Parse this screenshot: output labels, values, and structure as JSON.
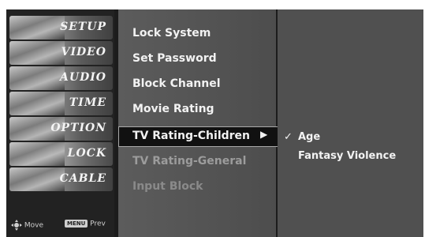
{
  "left_menu": {
    "items": [
      {
        "label": "SETUP"
      },
      {
        "label": "VIDEO"
      },
      {
        "label": "AUDIO"
      },
      {
        "label": "TIME"
      },
      {
        "label": "OPTION"
      },
      {
        "label": "LOCK"
      },
      {
        "label": "CABLE"
      }
    ],
    "footer": {
      "move_label": "Move",
      "prev_badge": "MENU",
      "prev_label": "Prev"
    }
  },
  "lock_menu": {
    "items": [
      {
        "label": "Lock System"
      },
      {
        "label": "Set Password"
      },
      {
        "label": "Block Channel"
      },
      {
        "label": "Movie Rating"
      },
      {
        "label": "TV Rating-Children",
        "arrow": "▶"
      },
      {
        "label": "TV Rating-General"
      },
      {
        "label": "Input Block"
      }
    ],
    "selected_index": 4
  },
  "submenu": {
    "items": [
      {
        "label": "Age",
        "check": "✓"
      },
      {
        "label": "Fantasy Violence"
      }
    ]
  },
  "icons": [
    "move-icon",
    "menu-badge-icon",
    "checkmark-icon",
    "arrow-right-icon"
  ]
}
